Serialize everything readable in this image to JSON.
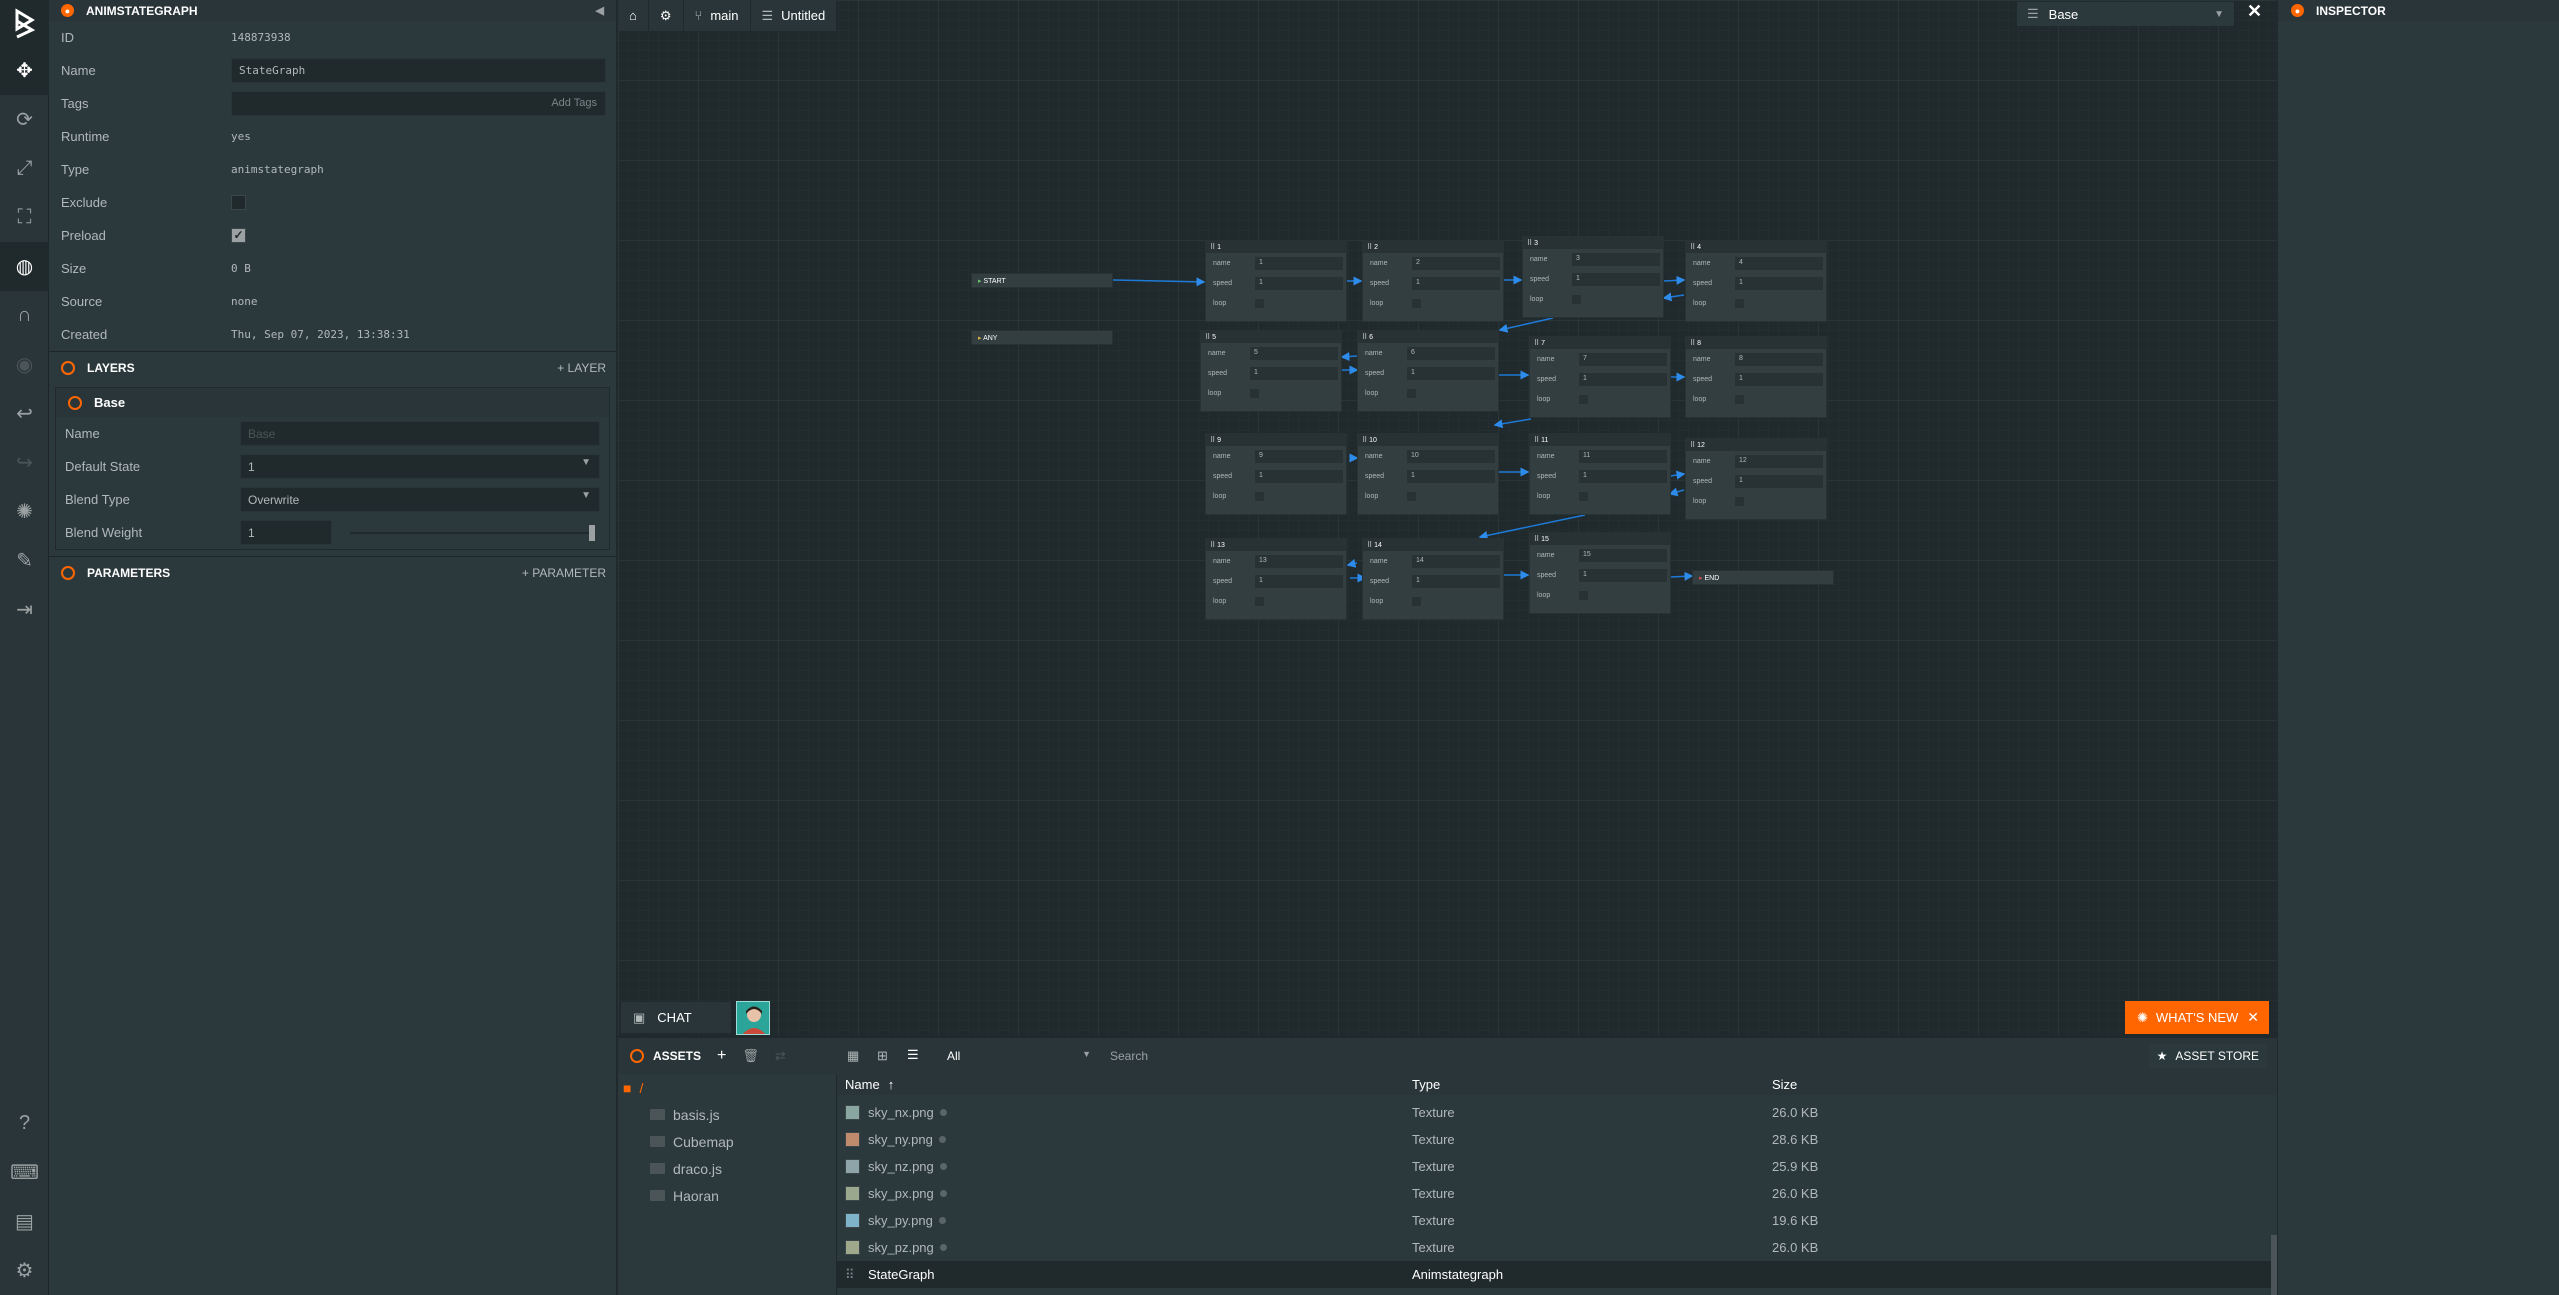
{
  "toolbar": {
    "logo": "playcanvas-logo",
    "items": [
      "move",
      "rotate",
      "scale",
      "resize",
      "world",
      "magnet",
      "eye",
      "undo",
      "redo",
      "light",
      "edit",
      "publish"
    ]
  },
  "anim_panel": {
    "title": "ANIMSTATEGRAPH",
    "fields": {
      "id_label": "ID",
      "id_value": "148873938",
      "name_label": "Name",
      "name_value": "StateGraph",
      "tags_label": "Tags",
      "tags_placeholder": "Add Tags",
      "runtime_label": "Runtime",
      "runtime_value": "yes",
      "type_label": "Type",
      "type_value": "animstategraph",
      "exclude_label": "Exclude",
      "preload_label": "Preload",
      "size_label": "Size",
      "size_value": "0 B",
      "source_label": "Source",
      "source_value": "none",
      "created_label": "Created",
      "created_value": "Thu, Sep 07, 2023, 13:38:31"
    }
  },
  "layers": {
    "title": "LAYERS",
    "add_label": "LAYER",
    "layer": {
      "title": "Base",
      "name_label": "Name",
      "name_placeholder": "Base",
      "default_state_label": "Default State",
      "default_state_value": "1",
      "blend_type_label": "Blend Type",
      "blend_type_value": "Overwrite",
      "blend_weight_label": "Blend Weight",
      "blend_weight_value": "1"
    }
  },
  "parameters": {
    "title": "PARAMETERS",
    "add_label": "PARAMETER"
  },
  "viewport_bar": {
    "branch": "main",
    "scene": "Untitled",
    "layer_select": "Base"
  },
  "graph": {
    "start": "START",
    "any": "ANY",
    "end": "END",
    "row_labels": {
      "name": "name",
      "speed": "speed",
      "loop": "loop"
    },
    "nodes": [
      {
        "t": "1",
        "n": "1",
        "s": "1"
      },
      {
        "t": "2",
        "n": "2",
        "s": "1"
      },
      {
        "t": "3",
        "n": "3",
        "s": "1"
      },
      {
        "t": "4",
        "n": "4",
        "s": "1"
      },
      {
        "t": "5",
        "n": "5",
        "s": "1"
      },
      {
        "t": "6",
        "n": "6",
        "s": "1"
      },
      {
        "t": "7",
        "n": "7",
        "s": "1"
      },
      {
        "t": "8",
        "n": "8",
        "s": "1"
      },
      {
        "t": "9",
        "n": "9",
        "s": "1"
      },
      {
        "t": "10",
        "n": "10",
        "s": "1"
      },
      {
        "t": "11",
        "n": "11",
        "s": "1"
      },
      {
        "t": "12",
        "n": "12",
        "s": "1"
      },
      {
        "t": "13",
        "n": "13",
        "s": "1"
      },
      {
        "t": "14",
        "n": "14",
        "s": "1"
      },
      {
        "t": "15",
        "n": "15",
        "s": "1"
      }
    ]
  },
  "chat": {
    "label": "CHAT"
  },
  "whats_new": {
    "label": "WHAT'S NEW"
  },
  "inspector": {
    "title": "INSPECTOR"
  },
  "assets": {
    "title": "ASSETS",
    "filter": "All",
    "search_placeholder": "Search",
    "store": "ASSET STORE",
    "root": "/",
    "folders": [
      "basis.js",
      "Cubemap",
      "draco.js",
      "Haoran"
    ],
    "columns": {
      "name": "Name",
      "type": "Type",
      "size": "Size"
    },
    "rows": [
      {
        "name": "sky_nx.png",
        "type": "Texture",
        "size": "26.0 KB",
        "color": "#8aa6a0"
      },
      {
        "name": "sky_ny.png",
        "type": "Texture",
        "size": "28.6 KB",
        "color": "#c08a6c"
      },
      {
        "name": "sky_nz.png",
        "type": "Texture",
        "size": "25.9 KB",
        "color": "#8fa4a8"
      },
      {
        "name": "sky_px.png",
        "type": "Texture",
        "size": "26.0 KB",
        "color": "#9aa88e"
      },
      {
        "name": "sky_py.png",
        "type": "Texture",
        "size": "19.6 KB",
        "color": "#7fb3c9"
      },
      {
        "name": "sky_pz.png",
        "type": "Texture",
        "size": "26.0 KB",
        "color": "#a0a88c"
      },
      {
        "name": "StateGraph",
        "type": "Animstategraph",
        "size": "",
        "color": ""
      }
    ]
  }
}
